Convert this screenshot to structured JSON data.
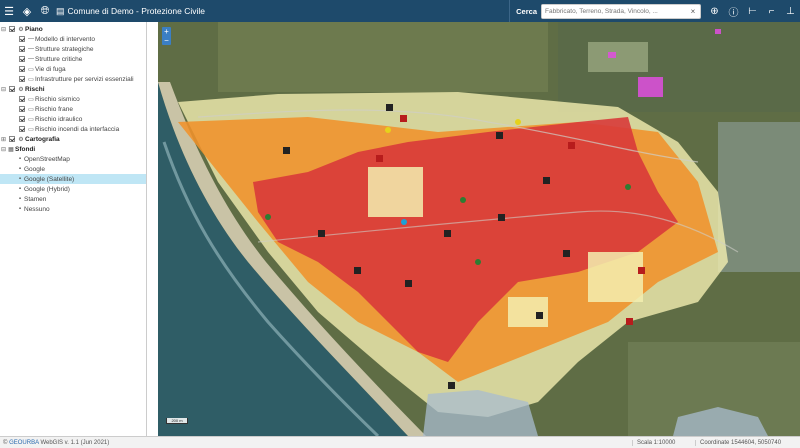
{
  "header": {
    "app_title": "Comune di Demo - Protezione Civile",
    "search_label": "Cerca",
    "search_placeholder": "Fabbricato, Terreno, Strada, Vincolo, ...",
    "search_value": "",
    "clear_glyph": "×"
  },
  "sidebar": {
    "groups": [
      {
        "label": "Piano",
        "expanded": true,
        "checked": true,
        "items": [
          {
            "label": "Modello di intervento"
          },
          {
            "label": "Strutture strategiche"
          },
          {
            "label": "Strutture critiche"
          },
          {
            "label": "Vie di fuga"
          },
          {
            "label": "Infrastrutture per servizi essenziali"
          }
        ]
      },
      {
        "label": "Rischi",
        "expanded": true,
        "checked": true,
        "items": [
          {
            "label": "Rischio sismico"
          },
          {
            "label": "Rischio frane"
          },
          {
            "label": "Rischio idraulico"
          },
          {
            "label": "Rischio incendi da interfaccia"
          }
        ]
      },
      {
        "label": "Cartografia",
        "expanded": false,
        "checked": true,
        "items": []
      }
    ],
    "basemaps": {
      "label": "Sfondi",
      "items": [
        "OpenStreetMap",
        "Google",
        "Google (Satellite)",
        "Google (Hybrid)",
        "Stamen",
        "Nessuno"
      ],
      "selected": "Google (Satellite)"
    }
  },
  "map": {
    "zoom_in": "+",
    "zoom_out": "−",
    "scale_bar": "200 m",
    "colors": {
      "high_risk": "#d83a3a",
      "medium_risk": "#f0922b",
      "low_risk": "#f3eeb0",
      "sea": "#2f5d66",
      "land": "#5f6d45"
    }
  },
  "status": {
    "brand": "GEOURBA",
    "copyright": "©",
    "version_text": "WebGIS v. 1.1 (Jun 2021)",
    "scale": "Scala 1:10000",
    "coordinates": "Coordinate 1544604, 5050740"
  },
  "icons": {
    "menu": "menu-icon",
    "layers": "layers-icon",
    "globe": "globe-icon",
    "book": "map-book-icon",
    "zoom_search": "zoom-search-icon",
    "info": "info-icon",
    "measure_line": "measure-line-icon",
    "measure_area": "measure-area-icon",
    "pin": "pin-icon"
  }
}
